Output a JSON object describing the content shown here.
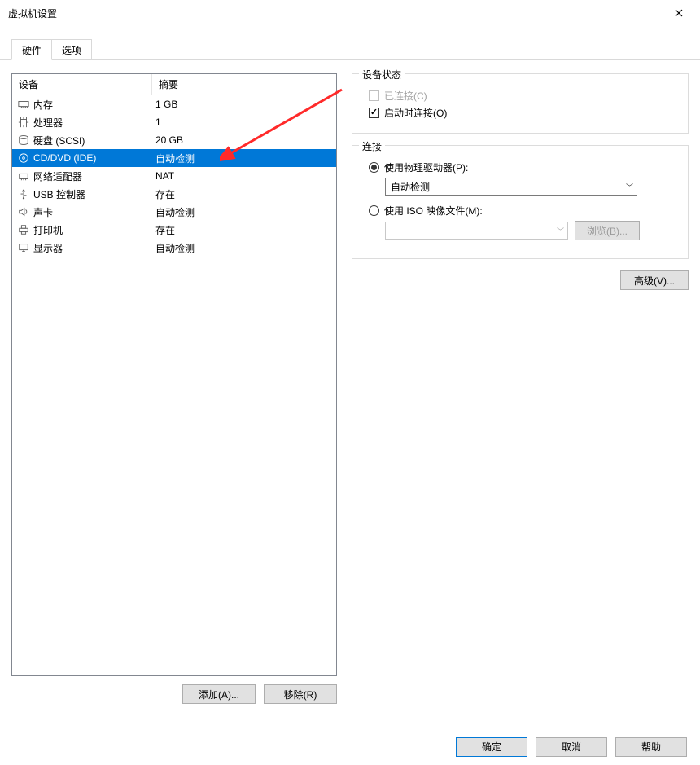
{
  "window": {
    "title": "虚拟机设置"
  },
  "tabs": {
    "hardware": "硬件",
    "options": "选项"
  },
  "columns": {
    "device": "设备",
    "summary": "摘要"
  },
  "devices": [
    {
      "name": "内存",
      "summary": "1 GB",
      "icon": "memory"
    },
    {
      "name": "处理器",
      "summary": "1",
      "icon": "cpu"
    },
    {
      "name": "硬盘 (SCSI)",
      "summary": "20 GB",
      "icon": "hdd"
    },
    {
      "name": "CD/DVD (IDE)",
      "summary": "自动检测",
      "icon": "cd",
      "selected": true
    },
    {
      "name": "网络适配器",
      "summary": "NAT",
      "icon": "net"
    },
    {
      "name": "USB 控制器",
      "summary": "存在",
      "icon": "usb"
    },
    {
      "name": "声卡",
      "summary": "自动检测",
      "icon": "sound"
    },
    {
      "name": "打印机",
      "summary": "存在",
      "icon": "printer"
    },
    {
      "name": "显示器",
      "summary": "自动检测",
      "icon": "display"
    }
  ],
  "left_buttons": {
    "add": "添加(A)...",
    "remove": "移除(R)"
  },
  "status_group": {
    "title": "设备状态",
    "connected": "已连接(C)",
    "connect_at_poweron": "启动时连接(O)"
  },
  "conn_group": {
    "title": "连接",
    "use_physical": "使用物理驱动器(P):",
    "physical_value": "自动检测",
    "use_iso": "使用 ISO 映像文件(M):",
    "browse": "浏览(B)..."
  },
  "advanced": "高级(V)...",
  "footer": {
    "ok": "确定",
    "cancel": "取消",
    "help": "帮助"
  }
}
